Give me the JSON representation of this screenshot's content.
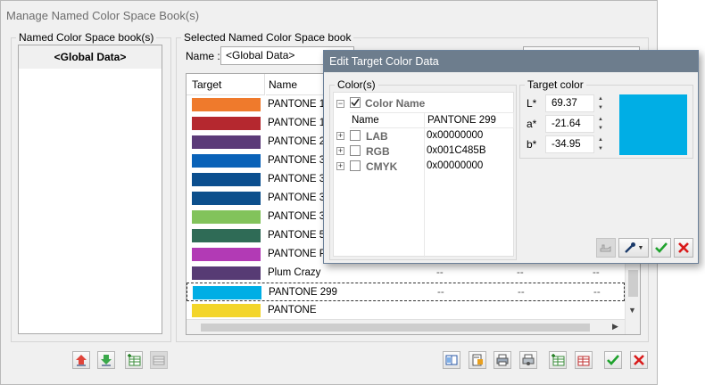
{
  "window": {
    "title": "Manage Named Color Space Book(s)"
  },
  "books_panel": {
    "legend": "Named Color Space book(s)",
    "items": [
      "<Global Data>"
    ]
  },
  "selected_panel": {
    "legend": "Selected Named Color Space book",
    "name_label": "Name :",
    "name_value": "<Global Data>",
    "columns": [
      "Target",
      "Name"
    ],
    "rows": [
      {
        "color": "#ef7a2c",
        "name": "PANTONE 16",
        "c3": "",
        "c4": "",
        "c5": ""
      },
      {
        "color": "#b5282f",
        "name": "PANTONE 18",
        "c3": "",
        "c4": "",
        "c5": ""
      },
      {
        "color": "#5b3a78",
        "name": "PANTONE 26",
        "c3": "",
        "c4": "",
        "c5": ""
      },
      {
        "color": "#0a62b8",
        "name": "PANTONE 30",
        "c3": "",
        "c4": "",
        "c5": ""
      },
      {
        "color": "#0b4f8f",
        "name": "PANTONE 30",
        "c3": "",
        "c4": "",
        "c5": ""
      },
      {
        "color": "#0c4f8c",
        "name": "PANTONE 30",
        "c3": "",
        "c4": "",
        "c5": ""
      },
      {
        "color": "#82c35b",
        "name": "PANTONE 36",
        "c3": "",
        "c4": "",
        "c5": ""
      },
      {
        "color": "#2f6b56",
        "name": "PANTONE 56",
        "c3": "",
        "c4": "",
        "c5": ""
      },
      {
        "color": "#b23ab5",
        "name": "PANTONE Pu",
        "c3": "",
        "c4": "",
        "c5": ""
      },
      {
        "color": "#573b74",
        "name": "Plum Crazy",
        "c3": "--",
        "c4": "--",
        "c5": "--"
      },
      {
        "color": "#00aee5",
        "name": "PANTONE 299",
        "c3": "--",
        "c4": "--",
        "c5": "--"
      },
      {
        "color": "#f3d52a",
        "name": "PANTONE",
        "c3": "",
        "c4": "",
        "c5": ""
      }
    ]
  },
  "dialog": {
    "title": "Edit Target Color Data",
    "colors_legend": "Color(s)",
    "tree_root": "Color Name",
    "name_label": "Name",
    "name_value": "PANTONE 299",
    "nodes": [
      {
        "label": "LAB",
        "value": "0x00000000"
      },
      {
        "label": "RGB",
        "value": "0x001C485B"
      },
      {
        "label": "CMYK",
        "value": "0x00000000"
      }
    ],
    "target_legend": "Target color",
    "L_label": "L*",
    "L_value": "69.37",
    "a_label": "a*",
    "a_value": "-21.64",
    "b_label": "b*",
    "b_value": "-34.95",
    "swatch_color": "#00aee5"
  },
  "colors": {
    "ok": "#1fa22d",
    "cancel": "#d91b1b",
    "dialog_title_bg": "#6d7d8d"
  }
}
